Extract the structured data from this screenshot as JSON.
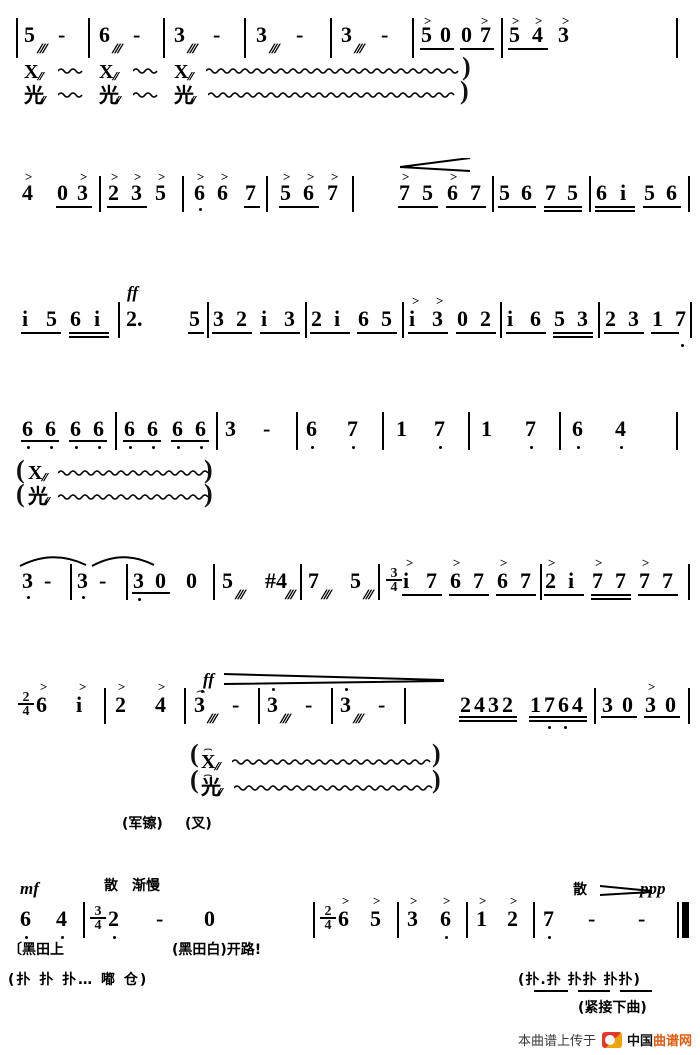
{
  "document": {
    "type": "jianpu-numbered-musical-notation",
    "language": "zh"
  },
  "systems": [
    {
      "id": "system-1",
      "notes": [
        "5",
        "6",
        "3",
        "3",
        "3",
        "5",
        "0",
        "0",
        "7",
        "5",
        "4",
        "3"
      ],
      "measures": [
        {
          "notes": [
            "5",
            "-"
          ]
        },
        {
          "notes": [
            "6",
            "-"
          ]
        },
        {
          "notes": [
            "3",
            "-"
          ]
        },
        {
          "notes": [
            "3",
            "-"
          ]
        },
        {
          "notes": [
            "3",
            "-"
          ]
        },
        {
          "notes": [
            "5",
            "0",
            "0",
            "7"
          ]
        },
        {
          "notes": [
            "5",
            "4",
            "3"
          ]
        }
      ],
      "percussion_row_1": [
        "X",
        "X",
        "X"
      ],
      "percussion_row_2": [
        "光",
        "光",
        "光"
      ]
    },
    {
      "id": "system-2",
      "measures": [
        {
          "notes": [
            "4",
            "0",
            "3"
          ]
        },
        {
          "notes": [
            "2",
            "3",
            "5"
          ]
        },
        {
          "notes": [
            "6",
            "6",
            "7"
          ]
        },
        {
          "notes": [
            "5",
            "6",
            "7"
          ]
        },
        {
          "notes": [
            "7",
            "5",
            "6",
            "7"
          ]
        },
        {
          "notes": [
            "5",
            "6",
            "7",
            "5"
          ]
        },
        {
          "notes": [
            "6",
            "i",
            "5",
            "6"
          ]
        }
      ],
      "hairpin": "crescendo"
    },
    {
      "id": "system-3",
      "dynamic": "ff",
      "measures": [
        {
          "notes": [
            "i",
            "5",
            "6",
            "i"
          ]
        },
        {
          "notes": [
            "2.",
            "5"
          ]
        },
        {
          "notes": [
            "3",
            "2",
            "i",
            "3"
          ]
        },
        {
          "notes": [
            "2",
            "i",
            "6",
            "5"
          ]
        },
        {
          "notes": [
            "i",
            "3",
            "0",
            "2"
          ]
        },
        {
          "notes": [
            "i",
            "6",
            "5",
            "3"
          ]
        },
        {
          "notes": [
            "2",
            "3",
            "1",
            "7"
          ]
        }
      ]
    },
    {
      "id": "system-4",
      "measures": [
        {
          "notes": [
            "6",
            "6",
            "6",
            "6"
          ]
        },
        {
          "notes": [
            "6",
            "6",
            "6",
            "6"
          ]
        },
        {
          "notes": [
            "3",
            "-"
          ]
        },
        {
          "notes": [
            "6",
            "7"
          ]
        },
        {
          "notes": [
            "1",
            "7"
          ]
        },
        {
          "notes": [
            "1",
            "7"
          ]
        },
        {
          "notes": [
            "6",
            "4"
          ]
        }
      ],
      "percussion_row_1": [
        "X"
      ],
      "percussion_row_2": [
        "光"
      ]
    },
    {
      "id": "system-5",
      "measures": [
        {
          "notes": [
            "3",
            "-"
          ]
        },
        {
          "notes": [
            "3",
            "-"
          ]
        },
        {
          "notes": [
            "3",
            "0",
            "0"
          ]
        },
        {
          "notes": [
            "5",
            "#4"
          ]
        },
        {
          "notes": [
            "7",
            "5"
          ]
        },
        {
          "time": "3/4",
          "notes": [
            "i",
            "7",
            "6",
            "7",
            "6",
            "7"
          ]
        },
        {
          "notes": [
            "2",
            "i",
            "7",
            "7",
            "7",
            "7"
          ]
        }
      ],
      "accidental": "#"
    },
    {
      "id": "system-6",
      "time": "2/4",
      "dynamic": "ff",
      "measures": [
        {
          "notes": [
            "6",
            "i"
          ]
        },
        {
          "notes": [
            "2",
            "4"
          ]
        },
        {
          "notes": [
            "3",
            "-"
          ]
        },
        {
          "notes": [
            "3",
            "-"
          ]
        },
        {
          "notes": [
            "3",
            "-"
          ]
        },
        {
          "notes": [
            "3",
            "-"
          ]
        },
        {
          "notes": [
            "2",
            "4",
            "3",
            "2",
            "1",
            "7",
            "6",
            "4"
          ]
        },
        {
          "notes": [
            "3",
            "0",
            "3",
            "0"
          ]
        }
      ],
      "percussion_row_1": [
        "X"
      ],
      "percussion_row_2": [
        "光"
      ],
      "annotation_left": "(军镲)",
      "annotation_right": "(叉)"
    },
    {
      "id": "system-7",
      "dynamic_left": "mf",
      "tempo_marks": [
        "散",
        "渐慢"
      ],
      "tempo_end": "散",
      "dynamic_end": "ppp",
      "measures": [
        {
          "notes": [
            "6",
            "4"
          ]
        },
        {
          "time": "3/4",
          "notes": [
            "2",
            "-",
            "0"
          ]
        },
        {
          "time": "2/4",
          "notes": [
            "6",
            "5"
          ]
        },
        {
          "notes": [
            "3",
            "6"
          ]
        },
        {
          "notes": [
            "1",
            "2"
          ]
        },
        {
          "notes": [
            "7",
            "-",
            "-"
          ]
        }
      ],
      "lyrics_line": "〔黑田上",
      "lyrics_line_2": "(黑田白)开路!",
      "percussion_syllables_left": "(扑  扑     扑…  嘟    仓)",
      "percussion_syllables_right": "(扑.扑  扑扑  扑扑)",
      "note_next": "(紧接下曲)"
    }
  ],
  "footer": {
    "text": "本曲谱上传于",
    "brand_1": "中国",
    "brand_2": "曲谱网",
    "logo": "qupu-logo"
  }
}
